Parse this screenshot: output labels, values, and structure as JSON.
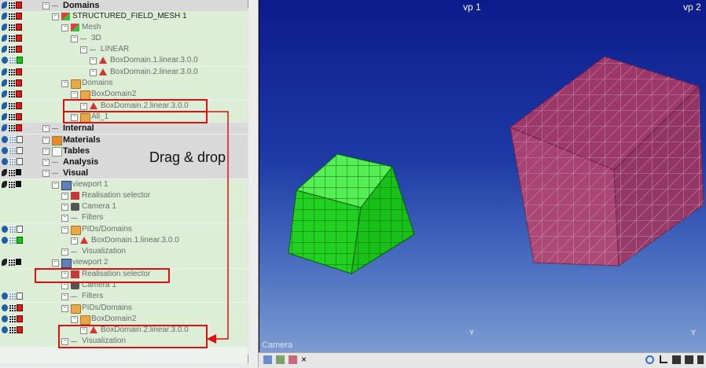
{
  "tree": {
    "rows": [
      {
        "label": "Domains",
        "style": "bold",
        "hl": "gray"
      },
      {
        "label": "STRUCTURED_FIELD_MESH 1",
        "style": "dark",
        "hl": "green"
      },
      {
        "label": "Mesh",
        "hl": "green"
      },
      {
        "label": "3D",
        "hl": "green"
      },
      {
        "label": "LINEAR",
        "hl": "green"
      },
      {
        "label": "BoxDomain.1.linear.3.0.0",
        "hl": "green"
      },
      {
        "label": "BoxDomain.2.linear.3.0.0",
        "hl": "green"
      },
      {
        "label": "Domains",
        "hl": "green"
      },
      {
        "label": "BoxDomain2",
        "hl": "green"
      },
      {
        "label": "BoxDomain.2.linear.3.0.0",
        "hl": "green"
      },
      {
        "label": "All_1",
        "hl": "green"
      },
      {
        "label": "Internal",
        "style": "bold",
        "hl": "gray"
      },
      {
        "label": "Materials",
        "style": "bold",
        "hl": "gray"
      },
      {
        "label": "Tables",
        "style": "bold",
        "hl": "gray"
      },
      {
        "label": "Analysis",
        "style": "bold",
        "hl": "gray"
      },
      {
        "label": "Visual",
        "style": "bold",
        "hl": "gray"
      },
      {
        "label": "viewport 1",
        "hl": "green"
      },
      {
        "label": "Realisation selector",
        "hl": "green"
      },
      {
        "label": "Camera 1",
        "hl": "green"
      },
      {
        "label": "Filters",
        "hl": "green"
      },
      {
        "label": "PIDs/Domains",
        "hl": "green"
      },
      {
        "label": "BoxDomain.1.linear.3.0.0",
        "hl": "green"
      },
      {
        "label": "Visualization",
        "hl": "green"
      },
      {
        "label": "viewport 2",
        "hl": "green"
      },
      {
        "label": "Realisation selector",
        "hl": "green"
      },
      {
        "label": "Camera 1",
        "hl": "green"
      },
      {
        "label": "Filters",
        "hl": "green"
      },
      {
        "label": "PIDs/Domains",
        "hl": "green"
      },
      {
        "label": "BoxDomain2",
        "hl": "green"
      },
      {
        "label": "BoxDomain.2.linear.3.0.0",
        "hl": "green"
      },
      {
        "label": "Visualization",
        "hl": "green"
      }
    ]
  },
  "annotation": {
    "drag_drop": "Drag & drop",
    "color": "#e01010"
  },
  "viewport": {
    "vp1_title": "vp 1",
    "vp2_title": "vp 2",
    "camera_label": "Camera",
    "axis1": "Y",
    "axis2": "Y",
    "green_box_color": "#22e022",
    "red_box_color": "#c8345a"
  },
  "bottombar": {
    "close_label": "×"
  }
}
